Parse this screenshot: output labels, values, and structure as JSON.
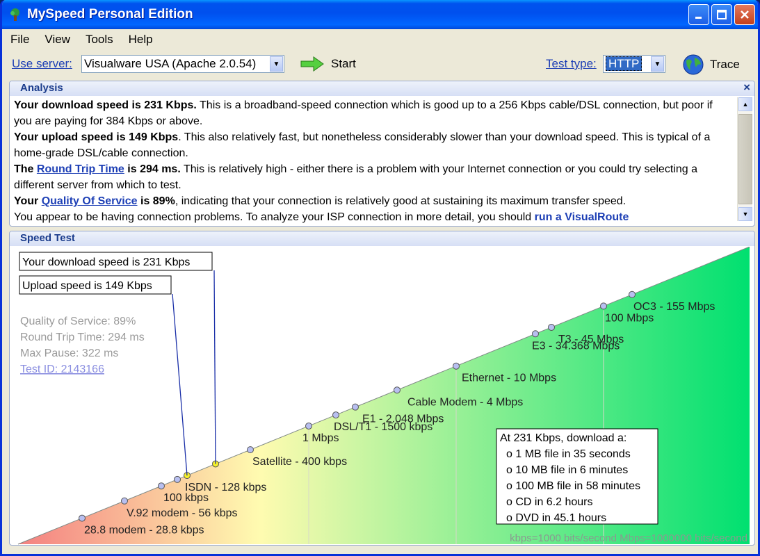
{
  "window": {
    "title": "MySpeed Personal Edition",
    "buttons": {
      "minimize": "▁",
      "maximize": "□",
      "close": "✕"
    }
  },
  "menu": [
    "File",
    "View",
    "Tools",
    "Help"
  ],
  "toolbar": {
    "server_label": "Use server:",
    "server_value": "Visualware USA (Apache 2.0.54)",
    "start_label": "Start",
    "test_type_label": "Test type:",
    "test_type_value": "HTTP",
    "trace_label": "Trace"
  },
  "analysis": {
    "header": "Analysis",
    "close": "×",
    "p1_bold": "Your download speed is 231 Kbps.",
    "p1_rest": " This is a broadband-speed connection which is good up to a 256 Kbps cable/DSL connection, but poor if you are paying for 384 Kbps or above.",
    "p2_bold": "Your upload speed is 149 Kbps",
    "p2_rest": ". This also relatively fast, but nonetheless considerably slower than your download speed. This is typical of a home-grade DSL/cable connection.",
    "p3_the": "The ",
    "p3_link": "Round Trip Time",
    "p3_bold": " is 294 ms.",
    "p3_rest": " This is relatively high - either there is a problem with your Internet connection or you could try selecting a different server from which to test.",
    "p4_your": "Your ",
    "p4_link": "Quality Of Service",
    "p4_bold": " is 89%",
    "p4_rest": ", indicating that your connection is relatively good at sustaining its maximum transfer speed.",
    "p5_text": "You appear to be having connection problems. To analyze your ISP connection in more detail, you should ",
    "p5_link": "run a VisualRoute"
  },
  "speed_test": {
    "header": "Speed Test",
    "download_callout": "Your download speed is 231 Kbps",
    "upload_callout": "Upload speed is 149 Kbps",
    "stats": [
      "Quality of Service: 89%",
      "Round Trip Time: 294 ms",
      "Max Pause: 322 ms"
    ],
    "test_id": "Test ID: 2143166",
    "download_box_title": "At 231 Kbps, download a:",
    "download_box_items": [
      "o 1 MB file in 35 seconds",
      "o 10 MB file in 6 minutes",
      "o 100 MB file in 58 minutes",
      "o CD in 6.2 hours",
      "o DVD in 45.1 hours"
    ],
    "footnote": "kbps=1000 bits/second  Mbps=1000000 bits/second",
    "colors": {
      "red": "#f48080",
      "yellow": "#fffbb0",
      "green": "#00e070",
      "marker": "#b8bff0",
      "marker_active": "#f5f02a",
      "callout_line": "#1a2fa8"
    },
    "markers": [
      {
        "label": "28.8 modem - 28.8 kbps",
        "kbps": 28.8
      },
      {
        "label": "V.92 modem - 56 kbps",
        "kbps": 56
      },
      {
        "label": "100 kbps",
        "kbps": 100
      },
      {
        "label": "",
        "kbps": 128
      },
      {
        "label": "ISDN - 128 kbps",
        "kbps": 149
      },
      {
        "label": "",
        "kbps": 231
      },
      {
        "label": "Satellite - 400 kbps",
        "kbps": 400
      },
      {
        "label": "1 Mbps",
        "kbps": 1000
      },
      {
        "label": "DSL/T1 - 1500 kbps",
        "kbps": 1500
      },
      {
        "label": "E1 - 2.048 Mbps",
        "kbps": 2048
      },
      {
        "label": "Cable Modem - 4 Mbps",
        "kbps": 4000
      },
      {
        "label": "Ethernet - 10 Mbps",
        "kbps": 10000
      },
      {
        "label": "E3 - 34.368 Mbps",
        "kbps": 34368
      },
      {
        "label": "T3 - 45 Mbps",
        "kbps": 45000
      },
      {
        "label": "100 Mbps",
        "kbps": 100000
      },
      {
        "label": "OC3 - 155 Mbps",
        "kbps": 155000
      }
    ]
  }
}
